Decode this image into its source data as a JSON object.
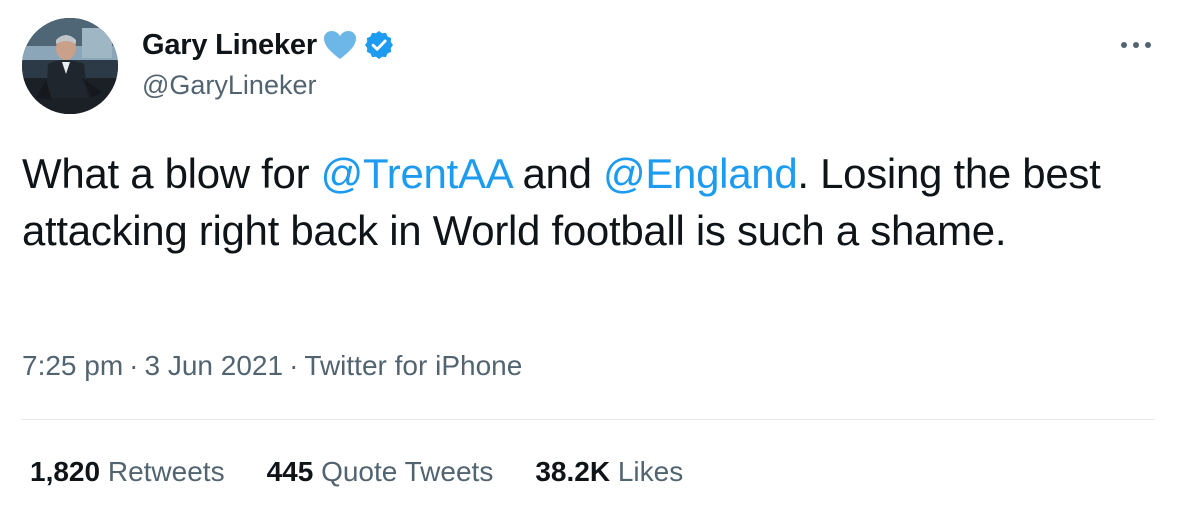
{
  "author": {
    "name": "Gary Lineker",
    "handle": "@GaryLineker",
    "avatar_icon": "profile-photo",
    "heart_color": "#6cb6e8",
    "verified_color": "#1d9bf0"
  },
  "menu": {
    "more_label": "···"
  },
  "tweet": {
    "text_part1": "What a blow for ",
    "mention1": "@TrentAA",
    "text_part2": " and ",
    "mention2": "@England",
    "text_part3": ". Losing the best attacking right back in World football is such a shame."
  },
  "meta": {
    "time": "7:25 pm",
    "separator": "·",
    "date": "3 Jun 2021",
    "source": "Twitter for iPhone"
  },
  "stats": {
    "retweets_count": "1,820",
    "retweets_label": "Retweets",
    "quotes_count": "445",
    "quotes_label": "Quote Tweets",
    "likes_count": "38.2K",
    "likes_label": "Likes"
  },
  "colors": {
    "link": "#1d9bf0",
    "secondary_text": "#536471",
    "primary_text": "#0f1419"
  }
}
